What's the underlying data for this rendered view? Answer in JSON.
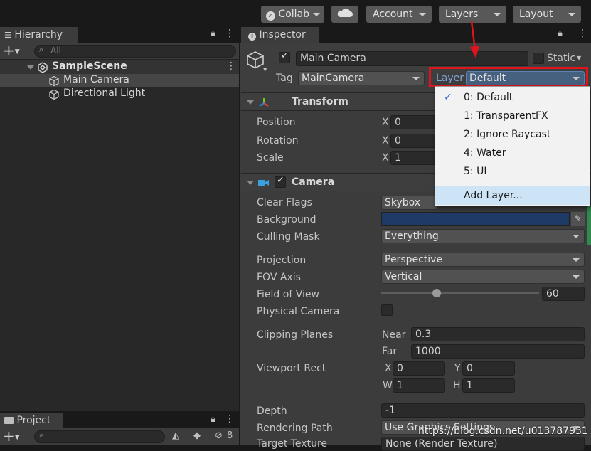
{
  "toolbar": {
    "collab": "Collab",
    "account": "Account",
    "layers": "Layers",
    "layout": "Layout"
  },
  "hierarchy": {
    "title": "Hierarchy",
    "search_placeholder": "All",
    "scene": "SampleScene",
    "items": [
      "Main Camera",
      "Directional Light"
    ]
  },
  "project": {
    "title": "Project",
    "hidden_count": "8"
  },
  "inspector": {
    "title": "Inspector",
    "object_name": "Main Camera",
    "static_label": "Static",
    "tag_label": "Tag",
    "tag_value": "MainCamera",
    "layer_label": "Layer",
    "layer_value": "Default"
  },
  "transform": {
    "title": "Transform",
    "rows": [
      {
        "label": "Position",
        "axis": "X",
        "value": "0"
      },
      {
        "label": "Rotation",
        "axis": "X",
        "value": "0"
      },
      {
        "label": "Scale",
        "axis": "X",
        "value": "1"
      }
    ]
  },
  "camera": {
    "title": "Camera",
    "clear_flags_label": "Clear Flags",
    "clear_flags_value": "Skybox",
    "background_label": "Background",
    "background_color": "#1f3a66",
    "culling_mask_label": "Culling Mask",
    "culling_mask_value": "Everything",
    "projection_label": "Projection",
    "projection_value": "Perspective",
    "fov_axis_label": "FOV Axis",
    "fov_axis_value": "Vertical",
    "fov_label": "Field of View",
    "fov_value": "60",
    "fov_fraction": 0.35,
    "physical_label": "Physical Camera",
    "clipping_label": "Clipping Planes",
    "near_label": "Near",
    "near_value": "0.3",
    "far_label": "Far",
    "far_value": "1000",
    "viewport_label": "Viewport Rect",
    "vp_x_label": "X",
    "vp_x": "0",
    "vp_y_label": "Y",
    "vp_y": "0",
    "vp_w_label": "W",
    "vp_w": "1",
    "vp_h_label": "H",
    "vp_h": "1",
    "depth_label": "Depth",
    "depth_value": "-1",
    "render_path_label": "Rendering Path",
    "render_path_value": "Use Graphics Settings",
    "target_texture_label": "Target Texture",
    "target_texture_value": "None (Render Texture)"
  },
  "layer_menu": {
    "items": [
      "0: Default",
      "1: TransparentFX",
      "2: Ignore Raycast",
      "4: Water",
      "5: UI"
    ],
    "add_layer": "Add Layer..."
  },
  "watermark": "https://blog.csdn.net/u013787931",
  "colors": {
    "highlight_red": "#e0141c",
    "menu_selected": "#3b6ea5",
    "checkmark": "#4a90d9"
  }
}
